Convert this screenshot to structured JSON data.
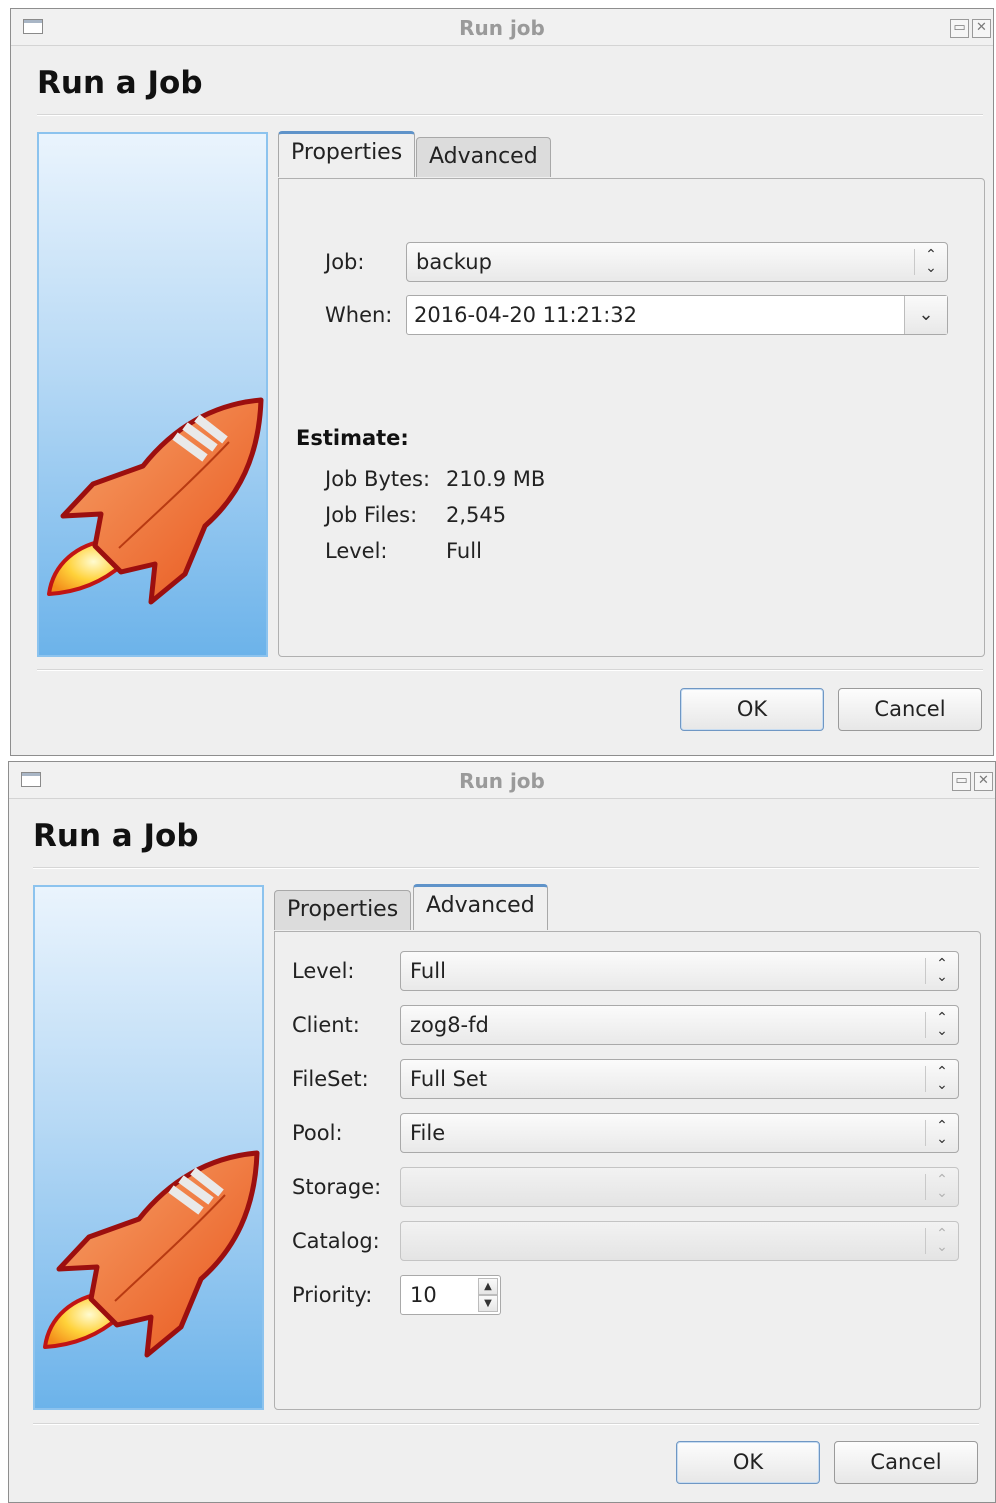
{
  "window1": {
    "title": "Run job",
    "heading": "Run a Job",
    "tabs": [
      {
        "label": "Properties",
        "active": true
      },
      {
        "label": "Advanced",
        "active": false
      }
    ],
    "job_label": "Job:",
    "job_value": "backup",
    "when_label": "When:",
    "when_value": "2016-04-20 11:21:32",
    "estimate_title": "Estimate:",
    "estimate": {
      "bytes_label": "Job Bytes:",
      "bytes_value": "210.9 MB",
      "files_label": "Job Files:",
      "files_value": "2,545",
      "level_label": "Level:",
      "level_value": "Full"
    },
    "ok_label": "OK",
    "cancel_label": "Cancel"
  },
  "window2": {
    "title": "Run job",
    "heading": "Run a Job",
    "tabs": [
      {
        "label": "Properties",
        "active": false
      },
      {
        "label": "Advanced",
        "active": true
      }
    ],
    "fields": [
      {
        "label": "Level:",
        "value": "Full",
        "enabled": true
      },
      {
        "label": "Client:",
        "value": "zog8-fd",
        "enabled": true
      },
      {
        "label": "FileSet:",
        "value": "Full Set",
        "enabled": true
      },
      {
        "label": "Pool:",
        "value": "File",
        "enabled": true
      },
      {
        "label": "Storage:",
        "value": "",
        "enabled": false
      },
      {
        "label": "Catalog:",
        "value": "",
        "enabled": false
      }
    ],
    "priority_label": "Priority:",
    "priority_value": "10",
    "ok_label": "OK",
    "cancel_label": "Cancel"
  },
  "icons": {
    "window_menu": "window-menu-icon",
    "maximize": "maximize-icon",
    "close": "close-icon",
    "rocket": "rocket-icon",
    "combo_arrows": "updown-chevron-icon",
    "dropdown": "chevron-down-icon"
  },
  "colors": {
    "tab_accent": "#5f93c9",
    "side_gradient_top": "#eaf4fd",
    "side_gradient_bottom": "#6cb3ea"
  }
}
